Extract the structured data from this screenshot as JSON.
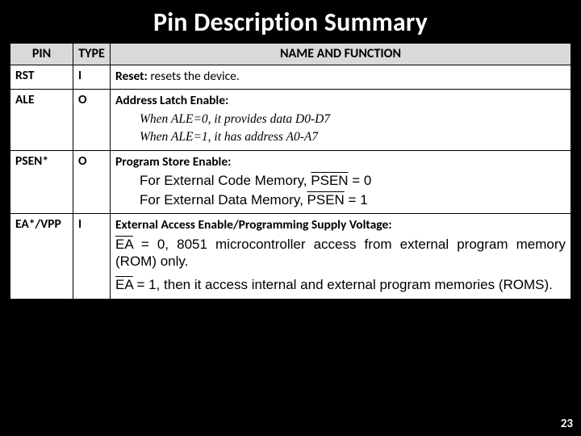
{
  "slide": {
    "title": "Pin Description Summary",
    "page_number": "23"
  },
  "table": {
    "headers": {
      "pin": "PIN",
      "type": "TYPE",
      "name_fn": "NAME AND FUNCTION"
    },
    "rows": [
      {
        "pin": "RST",
        "type": "I",
        "line1_bold": "Reset:",
        "line1_rest": " resets the device."
      },
      {
        "pin": "ALE",
        "type": "O",
        "line1_bold": "Address Latch Enable:",
        "d1": "When ALE=0, it provides data D0-D7",
        "d2": "When ALE=1, it has address A0-A7"
      },
      {
        "pin": "PSEN*",
        "type": "O",
        "line1_bold": "Program Store Enable:",
        "d1a": "For External Code Memory, ",
        "d1b_over": "PSEN",
        "d1c": " = 0",
        "d2a": "For External Data Memory, ",
        "d2b_over": "PSEN",
        "d2c": " = 1"
      },
      {
        "pin": "EA*/VPP",
        "type": "I",
        "line1_bold": "External Access Enable/Programming Supply Voltage:",
        "p1a_over": "EA",
        "p1b": " = 0, 8051 microcontroller access from external program memory (ROM) only.",
        "p2a_over": "EA",
        "p2b": " = 1, then it access internal and external program memories (ROMS)."
      }
    ]
  }
}
